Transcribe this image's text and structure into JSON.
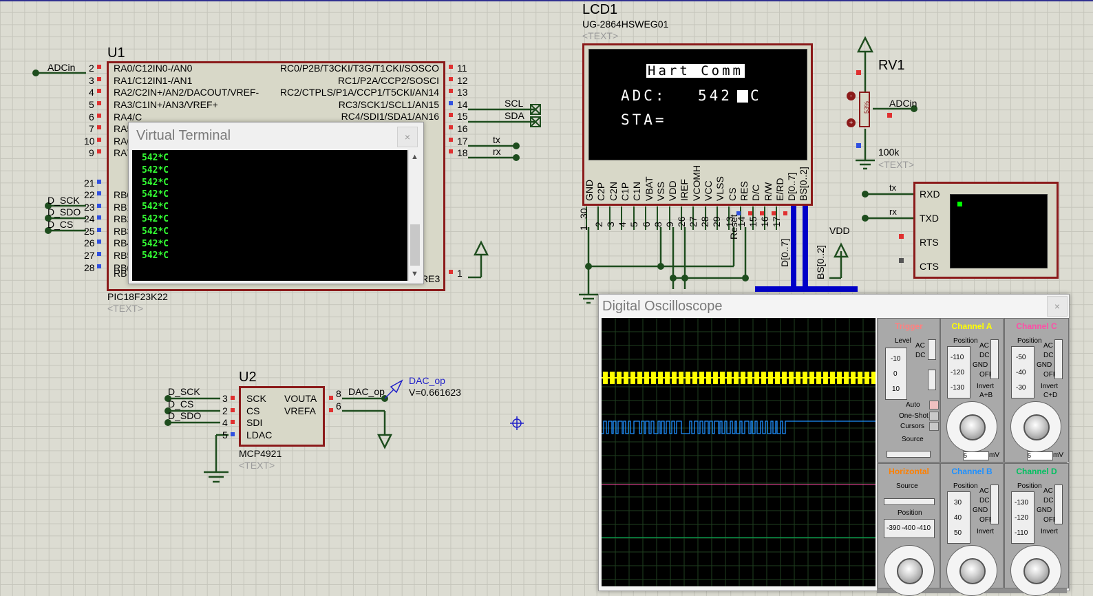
{
  "u1": {
    "ref": "U1",
    "part": "PIC18F23K22",
    "text_tag": "<TEXT>",
    "left_pins": [
      {
        "num": "2",
        "label": "RA0/C12IN0-/AN0"
      },
      {
        "num": "3",
        "label": "RA1/C12IN1-/AN1"
      },
      {
        "num": "4",
        "label": "RA2/C2IN+/AN2/DACOUT/VREF-"
      },
      {
        "num": "5",
        "label": "RA3/C1IN+/AN3/VREF+"
      },
      {
        "num": "6",
        "label": "RA4/C"
      },
      {
        "num": "7",
        "label": "RA5"
      },
      {
        "num": "10",
        "label": "RA6"
      },
      {
        "num": "9",
        "label": "RA7"
      },
      {
        "num": "21",
        "label": ""
      },
      {
        "num": "22",
        "label": "RB0"
      },
      {
        "num": "23",
        "label": "RB1"
      },
      {
        "num": "24",
        "label": "RB2"
      },
      {
        "num": "25",
        "label": "RB3"
      },
      {
        "num": "26",
        "label": "RB4"
      },
      {
        "num": "27",
        "label": "RB5"
      },
      {
        "num": "28",
        "label": "RB6"
      },
      {
        "num": "",
        "label": "RB7"
      }
    ],
    "right_pins": [
      {
        "num": "11",
        "label": "RC0/P2B/T3CKI/T3G/T1CKI/SOSCO"
      },
      {
        "num": "12",
        "label": "RC1/P2A/CCP2/SOSCI"
      },
      {
        "num": "13",
        "label": "RC2/CTPLS/P1A/CCP1/T5CKI/AN14"
      },
      {
        "num": "14",
        "label": "RC3/SCK1/SCL1/AN15"
      },
      {
        "num": "15",
        "label": "RC4/SDI1/SDA1/AN16"
      },
      {
        "num": "16",
        "label": ""
      },
      {
        "num": "17",
        "label": "17"
      },
      {
        "num": "18",
        "label": "18"
      },
      {
        "num": "1",
        "label": "RE3"
      }
    ],
    "nets_left": [
      "ADCin",
      "D_SCK",
      "D_SDO",
      "D_CS"
    ],
    "nets_right": [
      "SCL",
      "SDA",
      "tx",
      "rx"
    ]
  },
  "virtual_terminal": {
    "title": "Virtual Terminal",
    "close": "×",
    "lines": [
      "542*C",
      "542*C",
      "542*C",
      "542*C",
      "542*C",
      "542*C",
      "542*C",
      "542*C",
      "542*C"
    ]
  },
  "lcd": {
    "ref": "LCD1",
    "part": "UG-2864HSWEG01",
    "text_tag": "<TEXT>",
    "screen_line1": "Hart Comm",
    "screen_line2_label": "ADC:",
    "screen_line2_value": "542",
    "screen_line2_unit": "C",
    "screen_line3": "STA=",
    "pins": [
      "GND",
      "C2P",
      "C2N",
      "C1P",
      "C1N",
      "VBAT",
      "VSS",
      "VDD",
      "IREF",
      "VCOMH",
      "VCC",
      "VLSS",
      "CS",
      "RES",
      "D/C",
      "R/W",
      "E/RD",
      "D[0..7]",
      "BS[0..2]"
    ],
    "pin_numbers": [
      "1",
      "30",
      "2",
      "3",
      "4",
      "5",
      "6",
      "8",
      "9",
      "26",
      "27",
      "28",
      "29",
      "13",
      "14",
      "15",
      "16",
      "17"
    ],
    "net_reset": "Reset",
    "bus_d": "D[0..7]",
    "bus_bs": "BS[0..2]",
    "vdd_label": "VDD"
  },
  "rv1": {
    "ref": "RV1",
    "value": "100k",
    "text_tag": "<TEXT>",
    "percent": "53%",
    "net": "ADCin"
  },
  "serial": {
    "pins": [
      "RXD",
      "TXD",
      "RTS",
      "CTS"
    ],
    "net_tx": "tx",
    "net_rx": "rx"
  },
  "u2": {
    "ref": "U2",
    "part": "MCP4921",
    "text_tag": "<TEXT>",
    "left_pins": [
      {
        "num": "3",
        "label": "SCK",
        "net": "D_SCK"
      },
      {
        "num": "2",
        "label": "CS",
        "net": "D_CS"
      },
      {
        "num": "4",
        "label": "SDI",
        "net": "D_SDO"
      },
      {
        "num": "5",
        "label": "LDAC",
        "net": ""
      }
    ],
    "right_pins": [
      {
        "num": "8",
        "label": "VOUTA"
      },
      {
        "num": "6",
        "label": "VREFA"
      }
    ],
    "out_net": "DAC_op"
  },
  "probe": {
    "name": "DAC_op",
    "reading": "V=0.661623"
  },
  "oscilloscope": {
    "title": "Digital Oscilloscope",
    "close": "×",
    "trigger": {
      "title": "Trigger",
      "level": "Level",
      "ac": "AC",
      "dc": "DC",
      "auto": "Auto",
      "one_shot": "One-Shot",
      "cursors": "Cursors",
      "source": "Source",
      "ticks": [
        "-10",
        "0",
        "10"
      ],
      "color": "#ff8080"
    },
    "channel_a": {
      "title": "Channel A",
      "position": "Position",
      "ticks": [
        "-110",
        "-120",
        "-130"
      ],
      "modes": [
        "AC",
        "DC",
        "GND",
        "OFF"
      ],
      "invert": "Invert",
      "combo": "A+B",
      "scale_value": "5",
      "unit": "mV",
      "color": "#ffff00"
    },
    "channel_c": {
      "title": "Channel C",
      "position": "Position",
      "ticks": [
        "-50",
        "-40",
        "-30"
      ],
      "modes": [
        "AC",
        "DC",
        "GND",
        "OFF"
      ],
      "invert": "Invert",
      "combo": "C+D",
      "scale_value": "5",
      "unit": "mV",
      "color": "#ff4da6"
    },
    "horizontal": {
      "title": "Horizontal",
      "source": "Source",
      "position": "Position",
      "ticks": [
        "-390",
        "-400",
        "-410"
      ],
      "color": "#ff8000"
    },
    "channel_b": {
      "title": "Channel B",
      "position": "Position",
      "ticks": [
        "30",
        "40",
        "50"
      ],
      "modes": [
        "AC",
        "DC",
        "GND",
        "OFF"
      ],
      "invert": "Invert",
      "color": "#1e90ff"
    },
    "channel_d": {
      "title": "Channel D",
      "position": "Position",
      "ticks": [
        "-130",
        "-120",
        "-110"
      ],
      "modes": [
        "AC",
        "DC",
        "GND",
        "OFF"
      ],
      "invert": "Invert",
      "color": "#00c060"
    }
  }
}
